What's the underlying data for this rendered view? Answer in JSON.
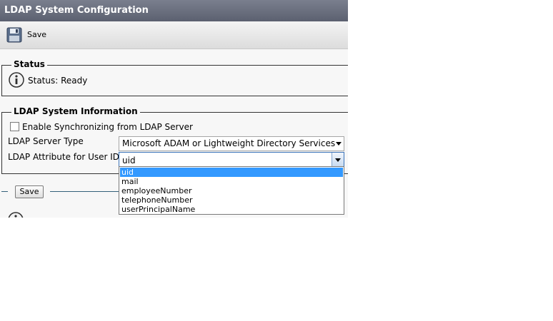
{
  "title": "LDAP System Configuration",
  "toolbar": {
    "save_label": "Save",
    "save_icon": "floppy-disk-icon"
  },
  "status": {
    "legend": "Status",
    "text": "Status: Ready",
    "icon": "info-icon"
  },
  "info": {
    "legend": "LDAP System Information",
    "sync_checkbox": {
      "label": "Enable Synchronizing from LDAP Server",
      "checked": false
    },
    "server_type": {
      "label": "LDAP Server Type",
      "value": "Microsoft ADAM or Lightweight Directory Services"
    },
    "user_id_attr": {
      "label": "LDAP Attribute for User ID",
      "value": "uid",
      "options": [
        "uid",
        "mail",
        "employeeNumber",
        "telephoneNumber",
        "userPrincipalName"
      ],
      "selected": "uid"
    }
  },
  "bottom": {
    "save_label": "Save"
  },
  "colors": {
    "title_bar": "#6b7080",
    "selected_option": "#3399ff"
  }
}
